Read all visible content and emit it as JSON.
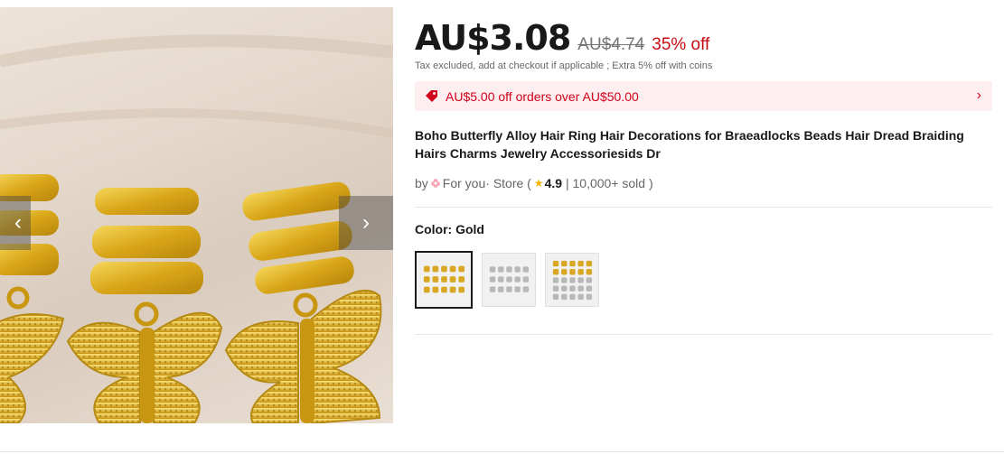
{
  "gallery": {
    "prev_icon": "chevron-left-icon",
    "next_icon": "chevron-right-icon",
    "prev_glyph": "‹",
    "next_glyph": "›"
  },
  "price": {
    "current": "AU$3.08",
    "original": "AU$4.74",
    "discount": "35% off",
    "tax_note": "Tax excluded, add at checkout if applicable ; Extra 5% off with coins"
  },
  "coupon": {
    "text": "AU$5.00 off orders over AU$50.00",
    "icon": "coupon-tag-icon",
    "chevron": "›"
  },
  "product": {
    "title": "Boho Butterfly Alloy Hair Ring Hair Decorations for Braeadlocks Beads Hair Dread Braiding Hairs Charms Jewelry Accessoriesids Dr"
  },
  "store": {
    "by": "by",
    "name": "For you",
    "suffix": "· Store (",
    "star": "★",
    "rating": "4.9",
    "sold": " | 10,000+ sold )"
  },
  "color": {
    "label": "Color: Gold",
    "options": [
      "Gold",
      "Silver",
      "Mixed"
    ],
    "selected": "Gold"
  },
  "colors": {
    "accent_red": "#c60c12",
    "coupon_bg": "#fdeef0",
    "gold": "#d8a825",
    "silver": "#b8b8b8"
  }
}
